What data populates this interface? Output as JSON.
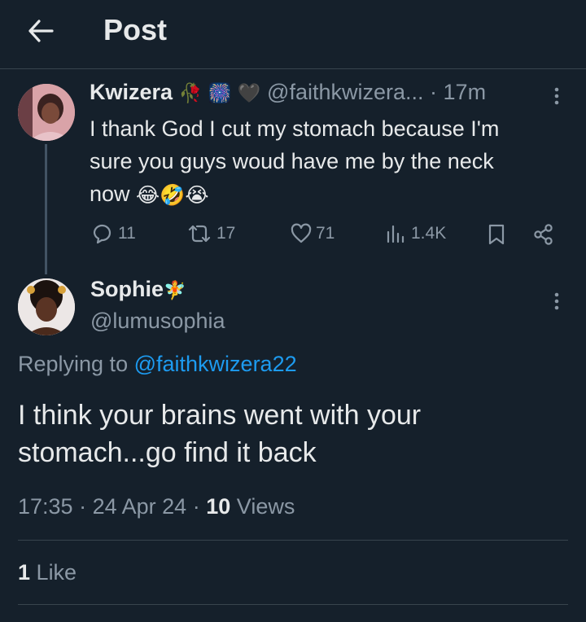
{
  "header": {
    "title": "Post"
  },
  "parent_post": {
    "author_name": "Kwizera",
    "name_emojis": [
      "🥀",
      "🎆",
      "🖤"
    ],
    "handle": "@faithkwizera...",
    "separator": "·",
    "time": "17m",
    "text_lines": [
      "I thank God I cut my stomach because I'm",
      "sure you guys woud have me by the neck",
      "now"
    ],
    "text_emojis": [
      "😂",
      "🤣",
      "😭"
    ],
    "actions": {
      "replies": "11",
      "reposts": "17",
      "likes": "71",
      "views": "1.4K"
    }
  },
  "reply_post": {
    "author_name": "Sophie",
    "name_emoji": "🧚",
    "handle": "@lumusophia",
    "replying_label": "Replying to",
    "replying_handle": "@faithkwizera22",
    "text_lines": [
      "I think your brains went with your",
      "stomach...go find it back"
    ],
    "meta": {
      "time": "17:35",
      "sep1": "·",
      "date": "24 Apr 24",
      "sep2": "·",
      "views_count": "10",
      "views_label": "Views"
    },
    "likes": {
      "count": "1",
      "label": "Like"
    }
  },
  "colors": {
    "background": "#15202b",
    "text": "#e7e9ea",
    "muted": "#8b98a5",
    "link": "#1d9bf0",
    "divider": "#38444d"
  }
}
